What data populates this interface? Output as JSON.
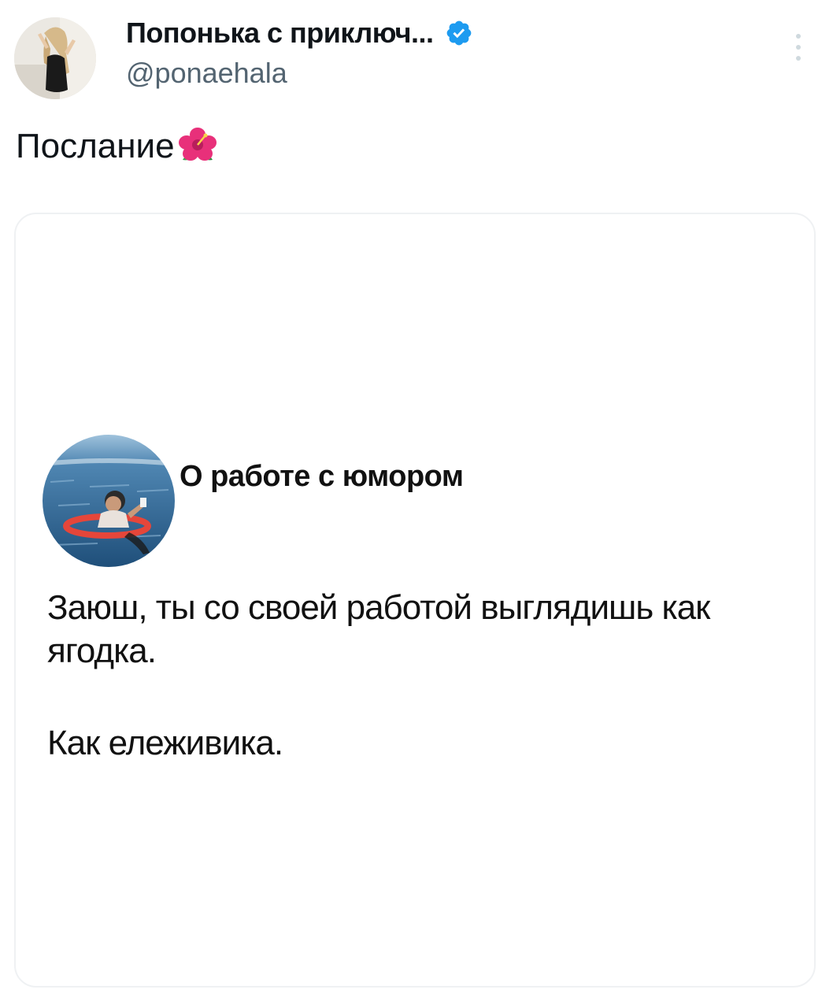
{
  "author": {
    "display_name": "Попонька с приключ...",
    "handle": "@ponaehala",
    "verified_icon": "verified-badge-icon",
    "verified_color": "#1d9bf0"
  },
  "tweet": {
    "text": "Послание",
    "emoji": "hibiscus-icon"
  },
  "media": {
    "title": "О работе с юмором",
    "line1": "Заюш, ты со своей работой выглядишь как ягодка.",
    "line2": "Как ележивика."
  },
  "colors": {
    "text_primary": "#0f1419",
    "text_secondary": "#536471",
    "card_border": "#eff1f3"
  }
}
